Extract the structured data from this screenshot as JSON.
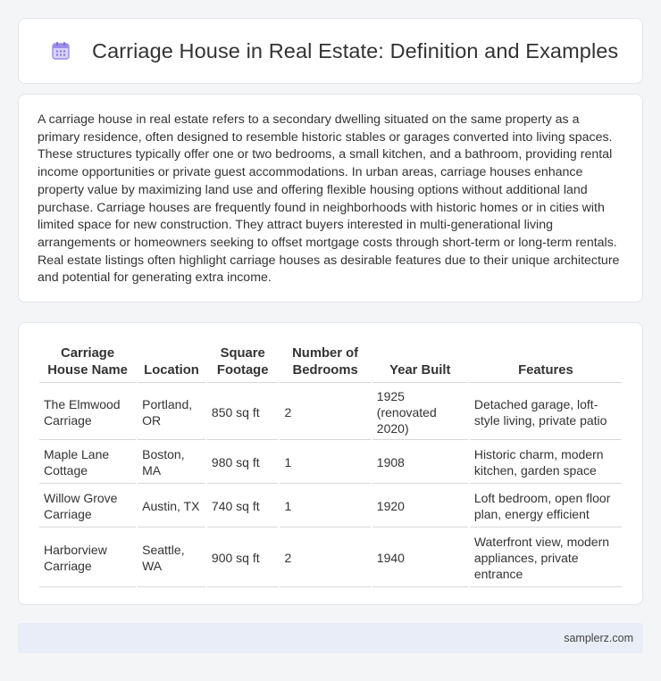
{
  "header": {
    "title": "Carriage House in Real Estate: Definition and Examples",
    "icon": "calendar-icon",
    "icon_color": "#9b8de8"
  },
  "intro": {
    "paragraph": "A carriage house in real estate refers to a secondary dwelling situated on the same property as a primary residence, often designed to resemble historic stables or garages converted into living spaces. These structures typically offer one or two bedrooms, a small kitchen, and a bathroom, providing rental income opportunities or private guest accommodations. In urban areas, carriage houses enhance property value by maximizing land use and offering flexible housing options without additional land purchase. Carriage houses are frequently found in neighborhoods with historic homes or in cities with limited space for new construction. They attract buyers interested in multi-generational living arrangements or homeowners seeking to offset mortgage costs through short-term or long-term rentals. Real estate listings often highlight carriage houses as desirable features due to their unique architecture and potential for generating extra income."
  },
  "table": {
    "headers": [
      "Carriage House Name",
      "Location",
      "Square Footage",
      "Number of Bedrooms",
      "Year Built",
      "Features"
    ],
    "rows": [
      [
        "The Elmwood Carriage",
        "Portland, OR",
        "850 sq ft",
        "2",
        "1925 (renovated 2020)",
        "Detached garage, loft-style living, private patio"
      ],
      [
        "Maple Lane Cottage",
        "Boston, MA",
        "980 sq ft",
        "1",
        "1908",
        "Historic charm, modern kitchen, garden space"
      ],
      [
        "Willow Grove Carriage",
        "Austin, TX",
        "740 sq ft",
        "1",
        "1920",
        "Loft bedroom, open floor plan, energy efficient"
      ],
      [
        "Harborview Carriage",
        "Seattle, WA",
        "900 sq ft",
        "2",
        "1940",
        "Waterfront view, modern appliances, private entrance"
      ]
    ]
  },
  "footer": {
    "site": "samplerz.com"
  }
}
